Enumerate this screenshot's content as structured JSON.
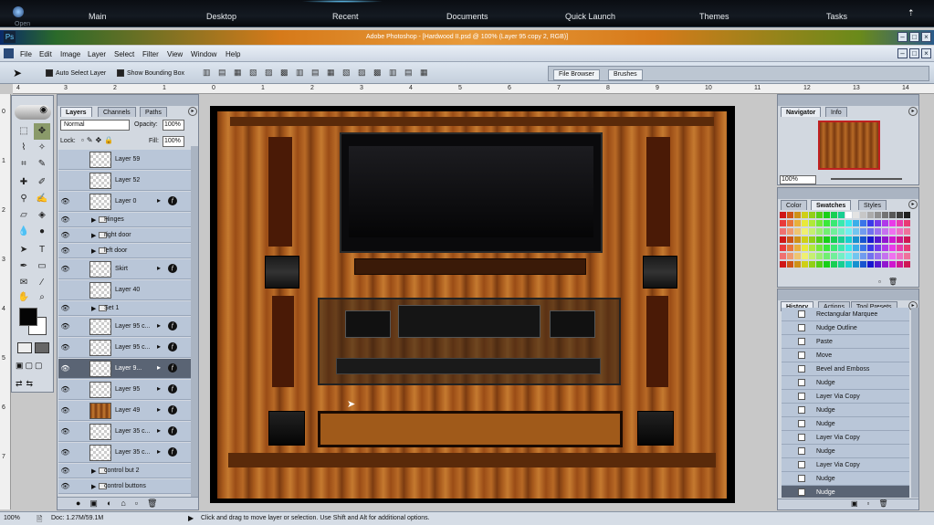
{
  "dock": {
    "open_label": "Open",
    "items": [
      "Main",
      "Desktop",
      "Recent",
      "Documents",
      "Quick Launch",
      "Themes",
      "Tasks"
    ]
  },
  "window": {
    "title": "Adobe Photoshop - [Hardwood II.psd @ 100% (Layer 95 copy 2, RGB)]"
  },
  "menu": [
    "File",
    "Edit",
    "Image",
    "Layer",
    "Select",
    "Filter",
    "View",
    "Window",
    "Help"
  ],
  "options": {
    "auto_select": "Auto Select Layer",
    "bounding_box": "Show Bounding Box",
    "tabs": [
      "File Browser",
      "Brushes"
    ]
  },
  "ruler_top": [
    "4",
    "3",
    "2",
    "1",
    "0",
    "1",
    "2",
    "3",
    "4",
    "5",
    "6",
    "7",
    "8",
    "9",
    "10",
    "11",
    "12",
    "13",
    "14"
  ],
  "ruler_left": [
    "0",
    "1",
    "2",
    "3",
    "4",
    "5",
    "6",
    "7"
  ],
  "layers_panel": {
    "tabs": [
      "Layers",
      "Channels",
      "Paths"
    ],
    "blend_mode": "Normal",
    "opacity_label": "Opacity:",
    "opacity_value": "100%",
    "lock_label": "Lock:",
    "fill_label": "Fill:",
    "fill_value": "100%",
    "rows": [
      {
        "name": "Layer 59",
        "type": "layer",
        "eye": false
      },
      {
        "name": "Layer 52",
        "type": "layer",
        "eye": false
      },
      {
        "name": "Layer 0",
        "type": "layer",
        "eye": true,
        "fx": true
      },
      {
        "name": "Hinges",
        "type": "group",
        "eye": true
      },
      {
        "name": "right door",
        "type": "group",
        "eye": true
      },
      {
        "name": "left door",
        "type": "group",
        "eye": true
      },
      {
        "name": "Skirt",
        "type": "layer",
        "eye": true,
        "fx": true
      },
      {
        "name": "Layer 40",
        "type": "layer",
        "eye": false
      },
      {
        "name": "Set 1",
        "type": "group",
        "eye": true
      },
      {
        "name": "Layer 95 c...",
        "type": "layer",
        "eye": true,
        "fx": true
      },
      {
        "name": "Layer 95 c...",
        "type": "layer",
        "eye": true,
        "fx": true
      },
      {
        "name": "Layer 9...",
        "type": "layer",
        "eye": true,
        "fx": true,
        "selected": true
      },
      {
        "name": "Layer 95",
        "type": "layer",
        "eye": true,
        "fx": true
      },
      {
        "name": "Layer 49",
        "type": "layer",
        "eye": true,
        "fx": true,
        "wood": true
      },
      {
        "name": "Layer 35 c...",
        "type": "layer",
        "eye": true,
        "fx": true
      },
      {
        "name": "Layer 35 c...",
        "type": "layer",
        "eye": true,
        "fx": true
      },
      {
        "name": "control but 2",
        "type": "group",
        "eye": true
      },
      {
        "name": "control buttons",
        "type": "group",
        "eye": true
      }
    ]
  },
  "navigator": {
    "tabs": [
      "Navigator",
      "Info"
    ],
    "zoom": "100%"
  },
  "color_panel": {
    "tabs": [
      "Color",
      "Swatches",
      "Styles"
    ]
  },
  "history_panel": {
    "tabs": [
      "History",
      "Actions",
      "Tool Presets"
    ],
    "items": [
      "Rectangular Marquee",
      "Nudge Outline",
      "Paste",
      "Move",
      "Bevel and Emboss",
      "Nudge",
      "Layer Via Copy",
      "Nudge",
      "Nudge",
      "Layer Via Copy",
      "Nudge",
      "Layer Via Copy",
      "Nudge",
      "Nudge"
    ]
  },
  "status": {
    "zoom": "100%",
    "doc": "Doc: 1.27M/59.1M",
    "hint": "Click and drag to move layer or selection. Use Shift and Alt for additional options."
  },
  "colors": {
    "accent_orange": "#e89a3a",
    "panel_bg": "#d2d8e0",
    "layer_row": "#b9c6d8",
    "selected_row": "#5a6474"
  }
}
